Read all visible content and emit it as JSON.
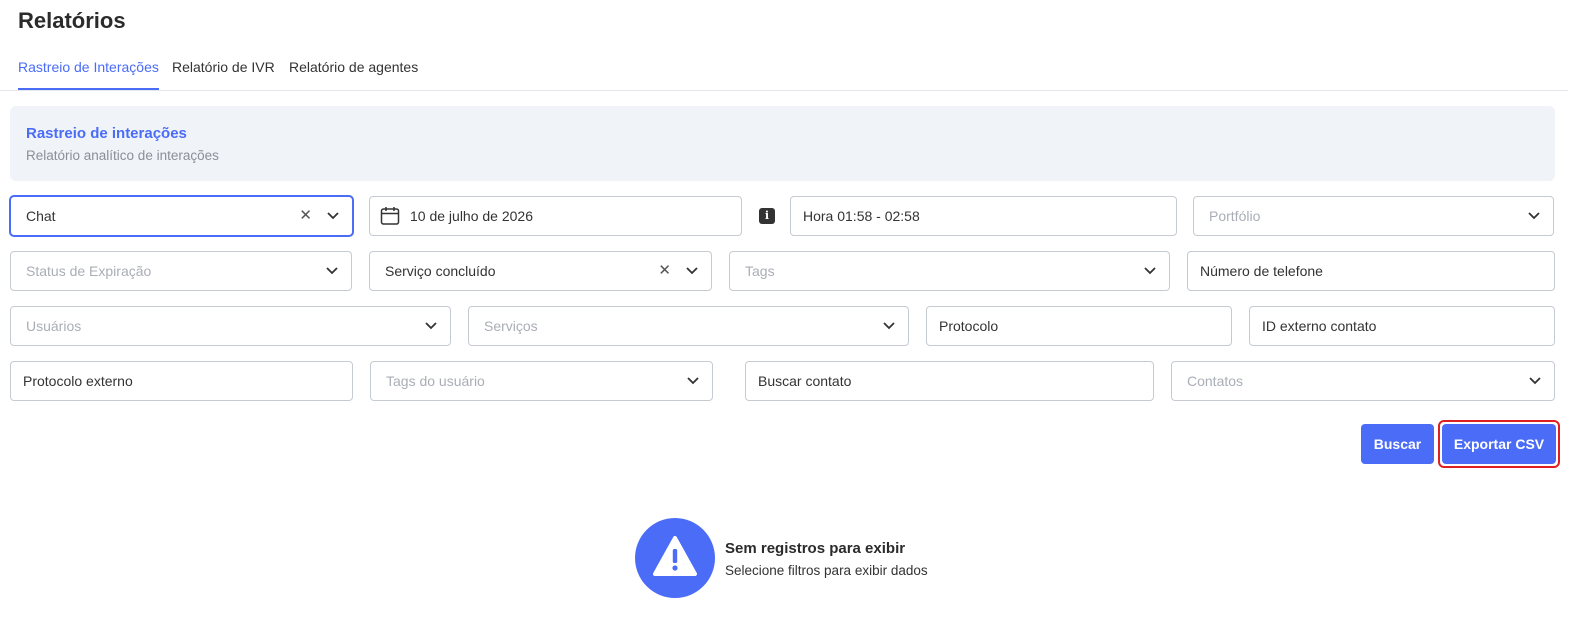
{
  "page": {
    "title": "Relatórios"
  },
  "tabs": [
    {
      "label": "Rastreio de Interações",
      "active": true
    },
    {
      "label": "Relatório de IVR",
      "active": false
    },
    {
      "label": "Relatório de agentes",
      "active": false
    }
  ],
  "banner": {
    "title": "Rastreio de interações",
    "subtitle": "Relatório analítico de interações"
  },
  "filters": {
    "channel": {
      "value": "Chat"
    },
    "date": {
      "value": "10 de julho de 2026"
    },
    "time": {
      "value": "Hora 01:58 - 02:58"
    },
    "portfolio": {
      "placeholder": "Portfólio"
    },
    "expiration_status": {
      "placeholder": "Status de Expiração"
    },
    "service_status": {
      "value": "Serviço concluído"
    },
    "tags": {
      "placeholder": "Tags"
    },
    "phone": {
      "placeholder": "Número de telefone"
    },
    "users": {
      "placeholder": "Usuários"
    },
    "services": {
      "placeholder": "Serviços"
    },
    "protocol": {
      "placeholder": "Protocolo"
    },
    "external_contact_id": {
      "placeholder": "ID externo contato"
    },
    "external_protocol": {
      "placeholder": "Protocolo externo"
    },
    "user_tags": {
      "placeholder": "Tags do usuário"
    },
    "search_contact": {
      "placeholder": "Buscar contato"
    },
    "contacts": {
      "placeholder": "Contatos"
    }
  },
  "actions": {
    "search_label": "Buscar",
    "export_label": "Exportar CSV"
  },
  "empty_state": {
    "title": "Sem registros para exibir",
    "subtitle": "Selecione filtros para exibir dados"
  },
  "colors": {
    "accent": "#4a6cf7",
    "banner_bg": "#f0f3f8",
    "highlight": "#e02020"
  }
}
